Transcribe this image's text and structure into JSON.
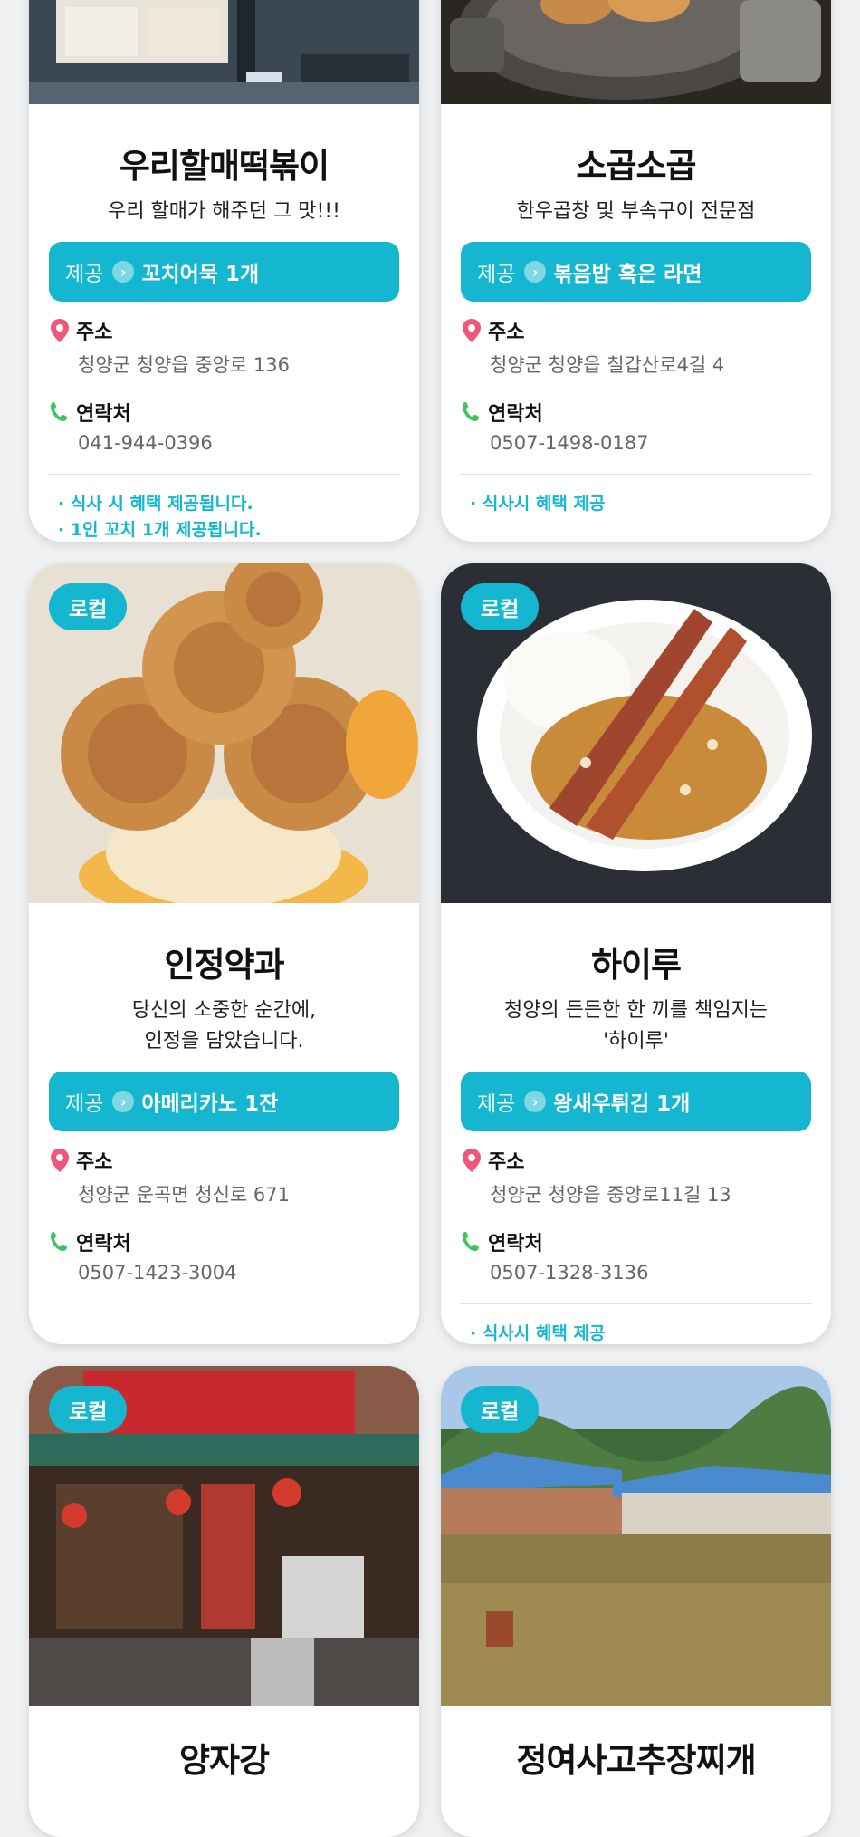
{
  "badge": "로컬",
  "offer_label": "제공",
  "labels": {
    "address": "주소",
    "contact": "연락처"
  },
  "colors": {
    "accent": "#14b7cf",
    "background": "#eef0f2"
  },
  "cards": [
    {
      "name": "우리할매떡볶이",
      "desc": "우리 할매가 해주던 그 맛!!!",
      "desc2": "",
      "offer": "꼬치어묵 1개",
      "address": "청양군 청양읍 중앙로 136",
      "phone": "041-944-0396",
      "notes": [
        "· 식사 시 혜택 제공됩니다.",
        "· 1인 꼬치 1개 제공됩니다."
      ]
    },
    {
      "name": "소곱소곱",
      "desc": "한우곱창 및 부속구이 전문점",
      "desc2": "",
      "offer": "볶음밥 혹은 라면",
      "address": "청양군 청양읍 칠갑산로4길 4",
      "phone": "0507-1498-0187",
      "notes": [
        "· 식사시 혜택 제공"
      ]
    },
    {
      "name": "인정약과",
      "desc": "당신의 소중한 순간에,",
      "desc2": "인정을 담았습니다.",
      "offer": "아메리카노 1잔",
      "address": "청양군 운곡면 청신로 671",
      "phone": "0507-1423-3004",
      "notes": []
    },
    {
      "name": "하이루",
      "desc": "청양의 든든한 한 끼를 책임지는",
      "desc2": "'하이루'",
      "offer": "왕새우튀김 1개",
      "address": "청양군 청양읍 중앙로11길 13",
      "phone": "0507-1328-3136",
      "notes": [
        "· 식사시 혜택 제공"
      ]
    },
    {
      "name": "양자강"
    },
    {
      "name": "정여사고추장찌개"
    }
  ]
}
